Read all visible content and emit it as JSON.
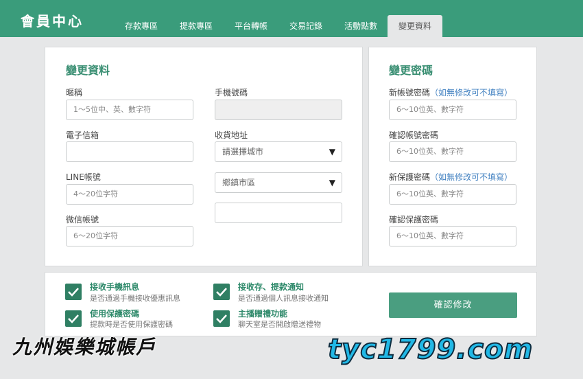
{
  "header": {
    "title": "會員中心",
    "tabs": [
      {
        "label": "存款專區"
      },
      {
        "label": "提款專區"
      },
      {
        "label": "平台轉帳"
      },
      {
        "label": "交易記錄"
      },
      {
        "label": "活動點數"
      },
      {
        "label": "變更資料",
        "active": true
      }
    ],
    "color": "#3a9c7b"
  },
  "profile": {
    "title": "變更資料",
    "nickname": {
      "label": "暱稱",
      "placeholder": "1～5位中、英、數字符"
    },
    "email": {
      "label": "電子信箱",
      "placeholder": ""
    },
    "line": {
      "label": "LINE帳號",
      "placeholder": "4～20位字符"
    },
    "wechat": {
      "label": "微信帳號",
      "placeholder": "6～20位字符"
    },
    "phone": {
      "label": "手機號碼",
      "value": ""
    },
    "address": {
      "label": "收貨地址",
      "city": "請選擇城市",
      "district": "鄉鎮市區",
      "detail": ""
    }
  },
  "password": {
    "title": "變更密碼",
    "new_account_pw": {
      "label": "新帳號密碼",
      "note": "（如無修改可不填寫）",
      "placeholder": "6～10位英、數字符"
    },
    "confirm_account_pw": {
      "label": "確認帳號密碼",
      "placeholder": "6～10位英、數字符"
    },
    "new_protect_pw": {
      "label": "新保護密碼",
      "note": "（如無修改可不填寫）",
      "placeholder": "6～10位英、數字符"
    },
    "confirm_protect_pw": {
      "label": "確認保護密碼",
      "placeholder": "6～10位英、數字符"
    }
  },
  "options": [
    {
      "title": "接收手機訊息",
      "desc": "是否通過手機接收優惠訊息",
      "checked": true
    },
    {
      "title": "使用保護密碼",
      "desc": "提款時是否使用保護密碼",
      "checked": true
    },
    {
      "title": "接收存、提款通知",
      "desc": "是否通過個人訊息接收通知",
      "checked": true
    },
    {
      "title": "主播贈禮功能",
      "desc": "聊天室是否開啟贈送禮物",
      "checked": true
    }
  ],
  "confirm_label": "確認修改",
  "watermark": {
    "left": "九州娛樂城帳戶",
    "right": "tyc1799.com"
  }
}
